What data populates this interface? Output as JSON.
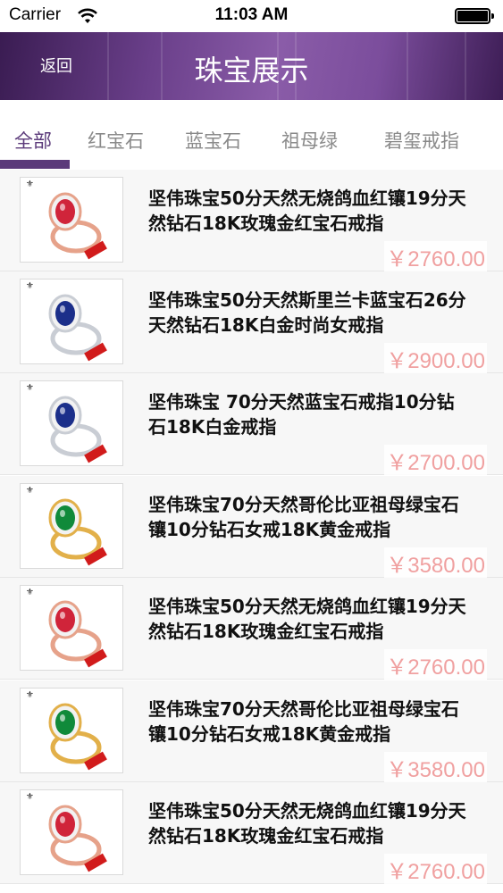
{
  "status_bar": {
    "carrier": "Carrier",
    "time": "11:03 AM"
  },
  "nav": {
    "back_label": "返回",
    "title": "珠宝展示"
  },
  "tabs": [
    {
      "label": "全部",
      "active": true
    },
    {
      "label": "红宝石",
      "active": false
    },
    {
      "label": "蓝宝石",
      "active": false
    },
    {
      "label": "祖母绿",
      "active": false
    },
    {
      "label": "碧玺戒指",
      "active": false
    }
  ],
  "colors": {
    "nav": "#6a3f8a",
    "accent": "#5b3a7a",
    "price": "#f0a0a0"
  },
  "products": [
    {
      "title": "坚伟珠宝50分天然无烧鸽血红镶19分天然钻石18K玫瑰金红宝石戒指",
      "price": "￥2760.00",
      "gem": "ruby",
      "metal": "rose-gold"
    },
    {
      "title": "坚伟珠宝50分天然斯里兰卡蓝宝石26分天然钻石18K白金时尚女戒指",
      "price": "￥2900.00",
      "gem": "sapphire",
      "metal": "white-gold"
    },
    {
      "title": "坚伟珠宝 70分天然蓝宝石戒指10分钻石18K白金戒指",
      "price": "￥2700.00",
      "gem": "sapphire",
      "metal": "white-gold"
    },
    {
      "title": "坚伟珠宝70分天然哥伦比亚祖母绿宝石镶10分钻石女戒18K黄金戒指",
      "price": "￥3580.00",
      "gem": "emerald",
      "metal": "yellow-gold"
    },
    {
      "title": "坚伟珠宝50分天然无烧鸽血红镶19分天然钻石18K玫瑰金红宝石戒指",
      "price": "￥2760.00",
      "gem": "ruby",
      "metal": "rose-gold"
    },
    {
      "title": "坚伟珠宝70分天然哥伦比亚祖母绿宝石镶10分钻石女戒18K黄金戒指",
      "price": "￥3580.00",
      "gem": "emerald",
      "metal": "yellow-gold"
    },
    {
      "title": "坚伟珠宝50分天然无烧鸽血红镶19分天然钻石18K玫瑰金红宝石戒指",
      "price": "￥2760.00",
      "gem": "ruby",
      "metal": "rose-gold"
    }
  ]
}
